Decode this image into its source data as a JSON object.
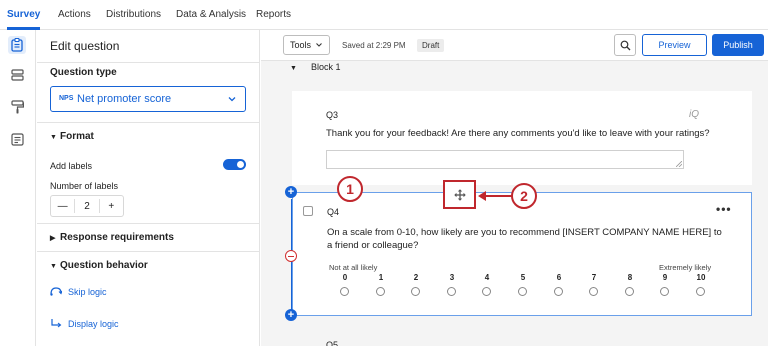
{
  "nav": {
    "tabs": [
      {
        "label": "Survey",
        "active": true
      },
      {
        "label": "Actions",
        "active": false
      },
      {
        "label": "Distributions",
        "active": false
      },
      {
        "label": "Data & Analysis",
        "active": false
      },
      {
        "label": "Reports",
        "active": false
      }
    ]
  },
  "rail": {
    "icons": [
      "survey-icon",
      "blocks-icon",
      "look-and-feel-icon",
      "survey-flow-icon"
    ]
  },
  "panel": {
    "title": "Edit question",
    "question_type_label": "Question type",
    "question_type_badge": "NPS",
    "question_type_value": "Net promoter score",
    "format_label": "Format",
    "add_labels_label": "Add labels",
    "add_labels_on": true,
    "number_of_labels_label": "Number of labels",
    "number_of_labels_value": "2",
    "stepper_minus": "—",
    "stepper_plus": "+",
    "response_requirements_label": "Response requirements",
    "question_behavior_label": "Question behavior",
    "skip_logic_label": "Skip logic",
    "display_logic_label": "Display logic"
  },
  "toolbar": {
    "tools_label": "Tools",
    "saved_text": "Saved at 2:29 PM",
    "draft_badge": "Draft",
    "preview_label": "Preview",
    "publish_label": "Publish"
  },
  "block": {
    "name": "Block 1"
  },
  "q3": {
    "id": "Q3",
    "text": "Thank you for your feedback! Are there any comments you'd like to leave with your ratings?",
    "iq_label": "iQ"
  },
  "q4": {
    "id": "Q4",
    "more": "•••",
    "text": "On a scale from 0-10, how likely are you to recommend [INSERT COMPANY NAME HERE] to a friend or colleague?",
    "left_anchor": "Not at all likely",
    "right_anchor": "Extremely likely",
    "scale": [
      "0",
      "1",
      "2",
      "3",
      "4",
      "5",
      "6",
      "7",
      "8",
      "9",
      "10"
    ]
  },
  "annotations": {
    "callout_1": "1",
    "callout_2": "2"
  },
  "q5": {
    "id": "Q5"
  },
  "colors": {
    "accent": "#1663d6",
    "callout_red": "#c0272d",
    "delete_red": "#d12f2f"
  }
}
